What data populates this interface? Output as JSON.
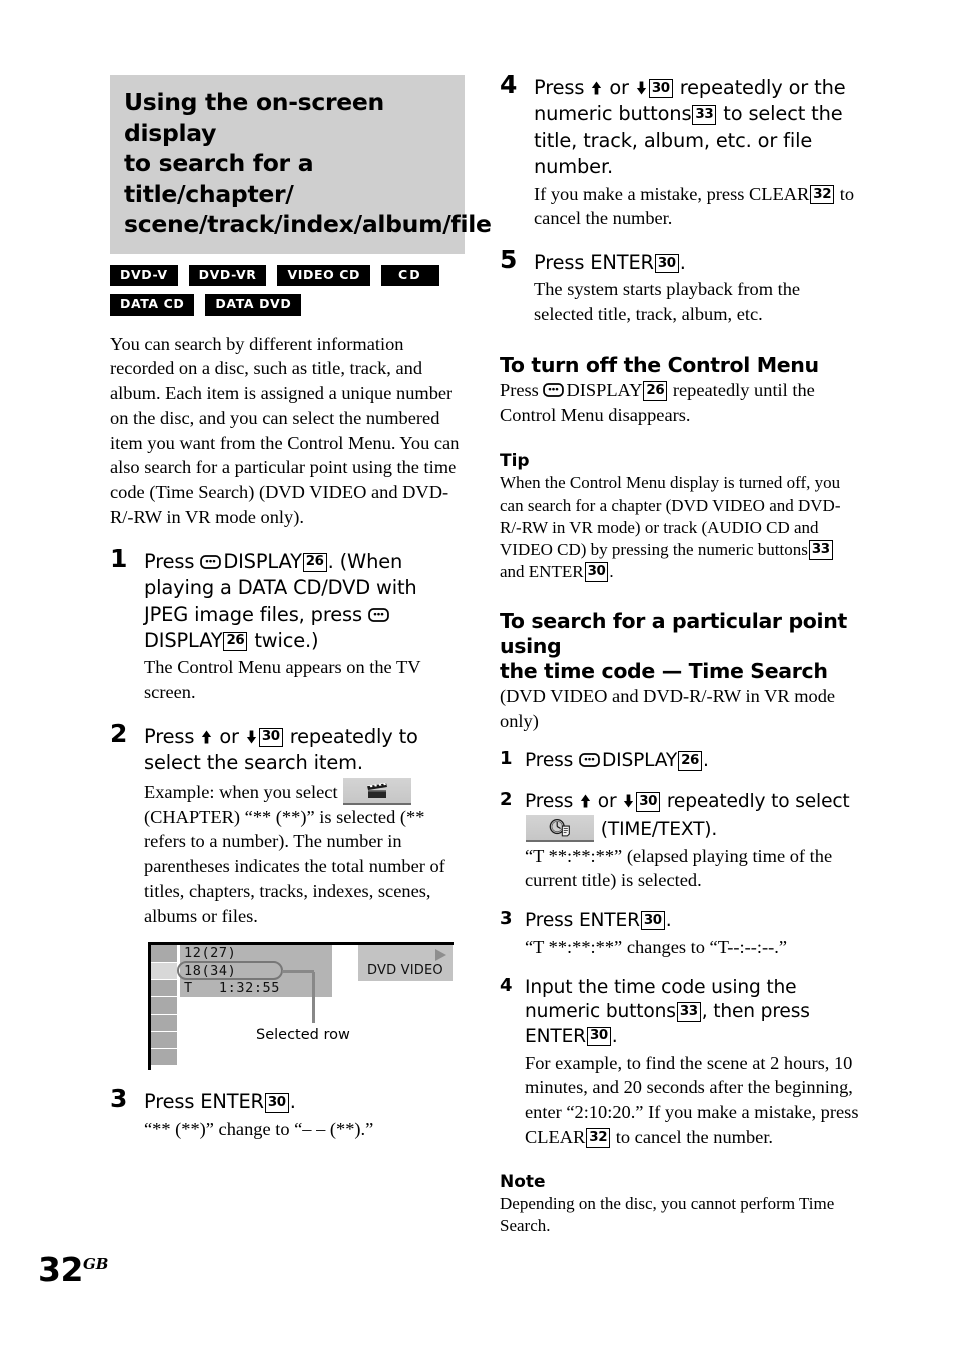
{
  "page": {
    "number": "32",
    "region_suffix": "GB"
  },
  "section": {
    "banner_title": "Using the on-screen display to search for a title/chapter/scene/track/index/album/file",
    "banner_lines": [
      "Using the on-screen display",
      "to search for a title/chapter/",
      "scene/track/index/album/file"
    ],
    "media_badges": [
      "DVD-V",
      "DVD-VR",
      "VIDEO CD",
      "CD",
      "DATA CD",
      "DATA DVD"
    ],
    "intro": "You can search by different information recorded on a disc, such as title, track, and album. Each item is assigned a unique number on the disc, and you can select the numbered item you want from the Control Menu. You can also search for a particular point using the time code (Time Search) (DVD VIDEO and DVD-R/-RW in VR mode only)."
  },
  "steps_main": [
    {
      "num": "1",
      "headline_a": "Press",
      "headline_b": "DISPLAY",
      "ref1": "26",
      "headline_c": ". (When playing a DATA CD/DVD with JPEG image files, press",
      "headline_d": "DISPLAY",
      "ref2": "26",
      "headline_e": "twice.)",
      "detail": "The Control Menu appears on the TV screen."
    },
    {
      "num": "2",
      "headline_a": "Press",
      "headline_or": "or",
      "ref1": "30",
      "headline_b": "repeatedly to select the search item.",
      "detail_a": "Example: when you select",
      "detail_b": "(CHAPTER)",
      "detail_c": "“** (**)” is selected (** refers to a number). The number in parentheses indicates the total number of titles, chapters, tracks, indexes, scenes, albums or files."
    },
    {
      "num": "3",
      "headline_a": "Press ENTER",
      "ref1": "30",
      "headline_b": ".",
      "detail": "“** (**)” change to “– – (**).”"
    }
  ],
  "osd": {
    "row1": "12(27)",
    "row2": "18(34)",
    "row3": "T   1:32:55",
    "disc_label": "DVD VIDEO",
    "callout": "Selected row"
  },
  "steps_right": [
    {
      "num": "4",
      "headline_a": "Press",
      "headline_or": "or",
      "ref1": "30",
      "headline_b": "repeatedly or the numeric buttons",
      "ref2": "33",
      "headline_c": "to select the title, track, album, etc. or file number.",
      "detail_a": "If you make a mistake, press CLEAR",
      "ref3": "32",
      "detail_b": "to cancel the number."
    },
    {
      "num": "5",
      "headline_a": "Press ENTER",
      "ref1": "30",
      "headline_b": ".",
      "detail": "The system starts playback from the selected title, track, album, etc."
    }
  ],
  "turn_off": {
    "heading": "To turn off the Control Menu",
    "text_a": "Press",
    "text_b": "DISPLAY",
    "ref1": "26",
    "text_c": "repeatedly until the Control Menu disappears."
  },
  "tip": {
    "heading": "Tip",
    "text_a": "When the Control Menu display is turned off, you can search for a chapter (DVD VIDEO and DVD-R/-RW in VR mode) or track (AUDIO CD and VIDEO CD) by pressing the numeric buttons",
    "ref1": "33",
    "text_b": "and ENTER",
    "ref2": "30",
    "text_c": "."
  },
  "time_search": {
    "heading_lines": [
      "To search for a particular point using",
      "the time code — Time Search"
    ],
    "heading": "To search for a particular point using the time code — Time Search",
    "subtitle": "(DVD VIDEO and DVD-R/-RW in VR mode only)",
    "steps": [
      {
        "num": "1",
        "headline_a": "Press",
        "headline_b": "DISPLAY",
        "ref1": "26",
        "headline_c": "."
      },
      {
        "num": "2",
        "headline_a": "Press",
        "headline_or": "or",
        "ref1": "30",
        "headline_b": "repeatedly to select",
        "headline_c": "(TIME/TEXT).",
        "detail": "“T **:**:**” (elapsed playing time of the current title) is selected."
      },
      {
        "num": "3",
        "headline_a": "Press ENTER",
        "ref1": "30",
        "headline_b": ".",
        "detail": "“T **:**:**” changes to “T--:--:--.”"
      },
      {
        "num": "4",
        "headline_a": "Input the time code using the numeric buttons",
        "ref1": "33",
        "headline_b": ", then press ENTER",
        "ref2": "30",
        "headline_c": ".",
        "detail_a": "For example, to find the scene at 2 hours, 10 minutes, and 20 seconds after the beginning, enter “2:10:20.” If you make a mistake, press CLEAR",
        "ref3": "32",
        "detail_b": "to cancel the number."
      }
    ]
  },
  "note": {
    "heading": "Note",
    "text": "Depending on the disc, you cannot perform Time Search."
  },
  "colors": {
    "banner_bg": "#cfcfcf",
    "badge_bg": "#000000",
    "osd_row_bg": "#b4b4b4",
    "osd_cell": "#a9a9a9",
    "osd_cell_active": "#d8d8d8"
  }
}
